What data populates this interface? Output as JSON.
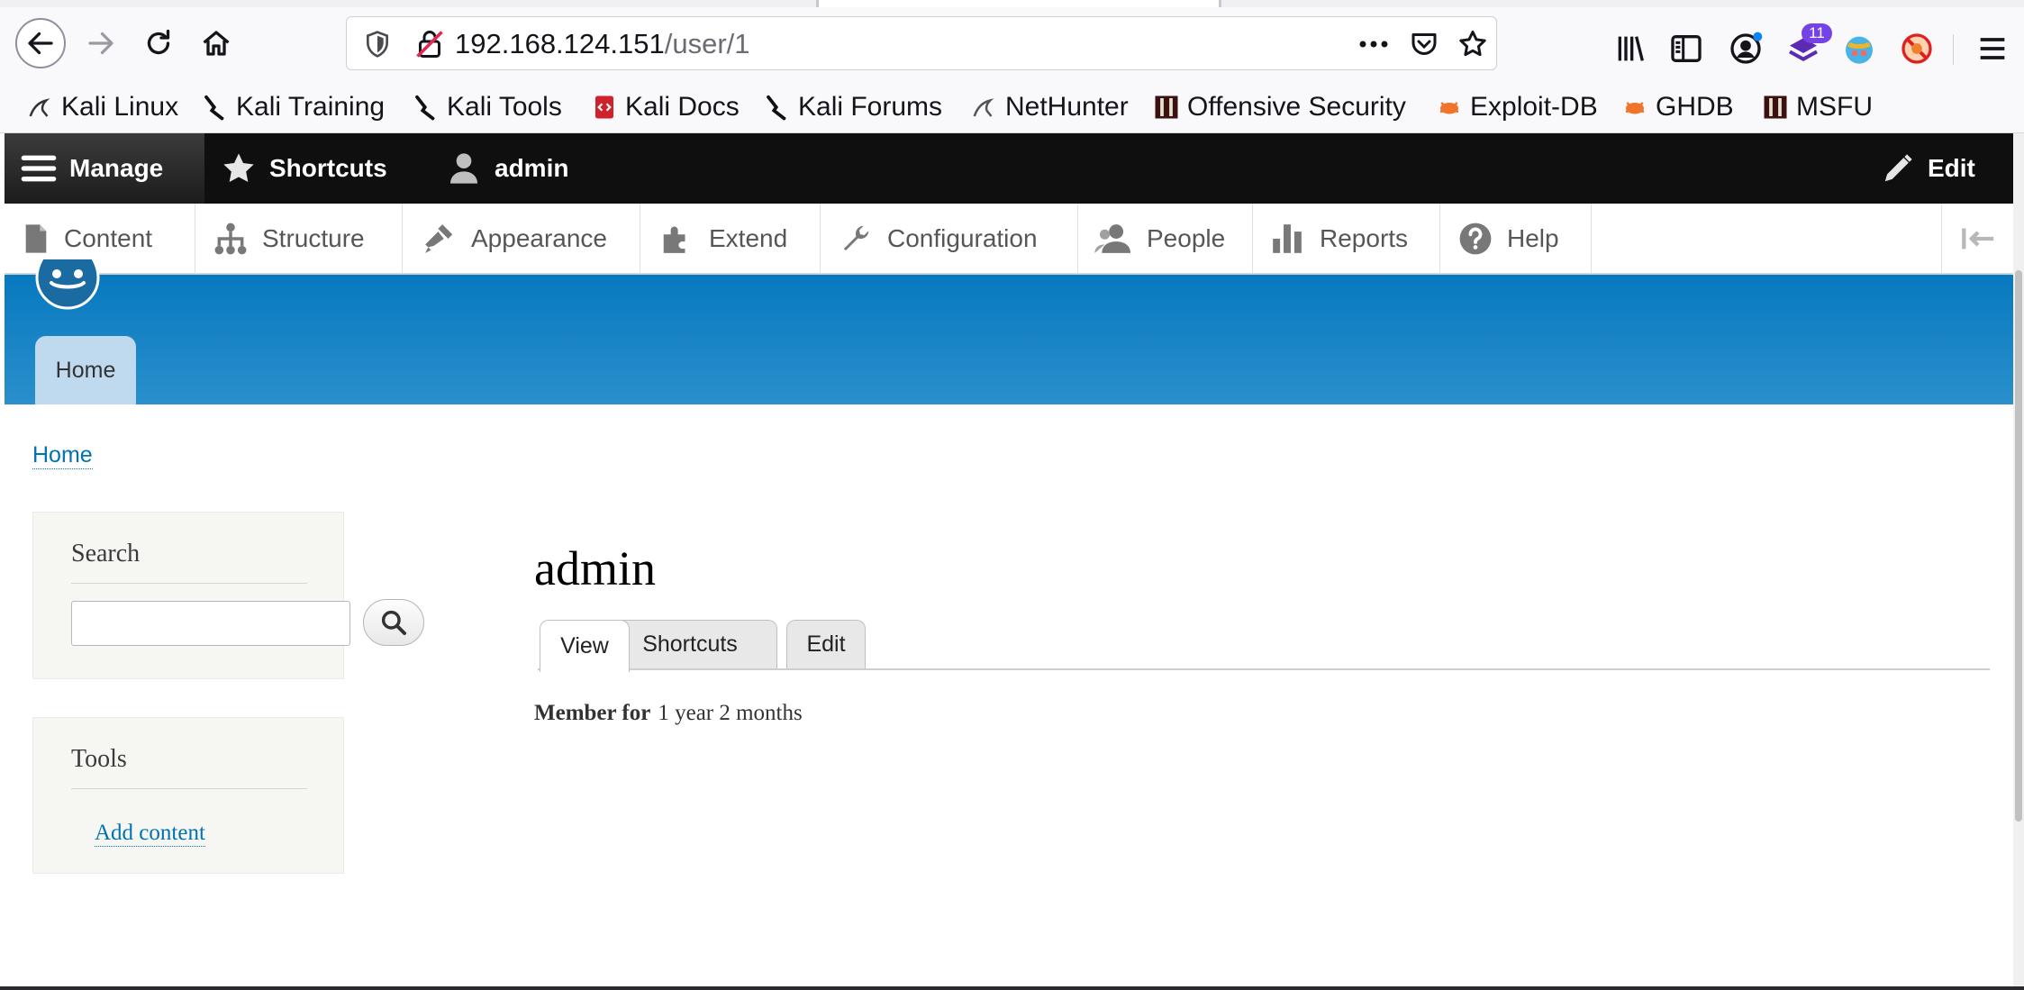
{
  "browser": {
    "url_host": "192.168.124.151",
    "url_path": "/user/1",
    "extension_badge": "11"
  },
  "bookmarks": [
    {
      "label": "Kali Linux",
      "icon": "kali-dragon-icon"
    },
    {
      "label": "Kali Training",
      "icon": "kali-training-icon"
    },
    {
      "label": "Kali Tools",
      "icon": "kali-tools-icon"
    },
    {
      "label": "Kali Docs",
      "icon": "kali-docs-icon"
    },
    {
      "label": "Kali Forums",
      "icon": "kali-forums-icon"
    },
    {
      "label": "NetHunter",
      "icon": "nethunter-icon"
    },
    {
      "label": "Offensive Security",
      "icon": "offsec-icon"
    },
    {
      "label": "Exploit-DB",
      "icon": "exploit-db-icon"
    },
    {
      "label": "GHDB",
      "icon": "ghdb-icon"
    },
    {
      "label": "MSFU",
      "icon": "msfu-icon"
    }
  ],
  "toolbar": {
    "manage": "Manage",
    "shortcuts": "Shortcuts",
    "user": "admin",
    "edit": "Edit"
  },
  "tray": {
    "items": [
      {
        "label": "Content",
        "icon": "content-icon"
      },
      {
        "label": "Structure",
        "icon": "structure-icon"
      },
      {
        "label": "Appearance",
        "icon": "appearance-icon"
      },
      {
        "label": "Extend",
        "icon": "extend-icon"
      },
      {
        "label": "Configuration",
        "icon": "configuration-icon"
      },
      {
        "label": "People",
        "icon": "people-icon"
      },
      {
        "label": "Reports",
        "icon": "reports-icon"
      },
      {
        "label": "Help",
        "icon": "help-icon"
      }
    ]
  },
  "site": {
    "primary_tab": "Home",
    "breadcrumb": "Home"
  },
  "sidebar": {
    "search_title": "Search",
    "tools_title": "Tools",
    "add_content": "Add content"
  },
  "main": {
    "title": "admin",
    "tabs": [
      "View",
      "Shortcuts",
      "Edit"
    ],
    "member_label": "Member for",
    "member_value": "1 year 2 months"
  },
  "colors": {
    "header_blue": "#0779bf",
    "link_blue": "#0071b3",
    "toolbar_black": "#0f0f0f"
  }
}
